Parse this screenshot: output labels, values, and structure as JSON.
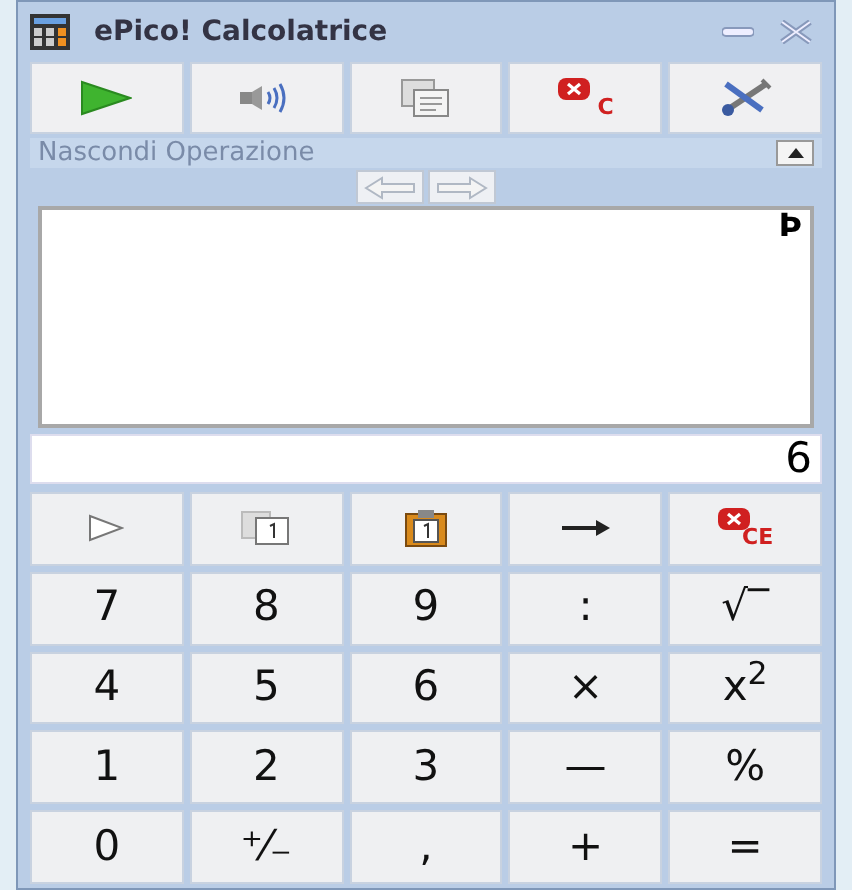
{
  "window": {
    "title": "ePico! Calcolatrice"
  },
  "toolbar": [
    {
      "kind": "play"
    },
    {
      "kind": "speaker"
    },
    {
      "kind": "copy"
    },
    {
      "kind": "clear",
      "label": "C"
    },
    {
      "kind": "tools"
    }
  ],
  "tape_panel": {
    "title": "Nascondi Operazione",
    "expanded": true,
    "tape_text": "Þ"
  },
  "display": {
    "value": "6"
  },
  "keys": [
    {
      "kind": "play-outline"
    },
    {
      "kind": "copy-one"
    },
    {
      "kind": "paste-one"
    },
    {
      "kind": "arrow"
    },
    {
      "kind": "clear",
      "label": "CE"
    },
    {
      "kind": "text",
      "label": "7"
    },
    {
      "kind": "text",
      "label": "8"
    },
    {
      "kind": "text",
      "label": "9"
    },
    {
      "kind": "text",
      "label": ":"
    },
    {
      "kind": "text",
      "label": "√‾"
    },
    {
      "kind": "text",
      "label": "4"
    },
    {
      "kind": "text",
      "label": "5"
    },
    {
      "kind": "text",
      "label": "6"
    },
    {
      "kind": "text",
      "label": "×"
    },
    {
      "kind": "text",
      "label": "x$^{2}$"
    },
    {
      "kind": "text",
      "label": "1"
    },
    {
      "kind": "text",
      "label": "2"
    },
    {
      "kind": "text",
      "label": "3"
    },
    {
      "kind": "text",
      "label": "—"
    },
    {
      "kind": "text",
      "label": "%"
    },
    {
      "kind": "text",
      "label": "0"
    },
    {
      "kind": "text",
      "label": "⁺⁄₋"
    },
    {
      "kind": "text",
      "label": ","
    },
    {
      "kind": "text",
      "label": "+"
    },
    {
      "kind": "text",
      "label": "="
    }
  ]
}
